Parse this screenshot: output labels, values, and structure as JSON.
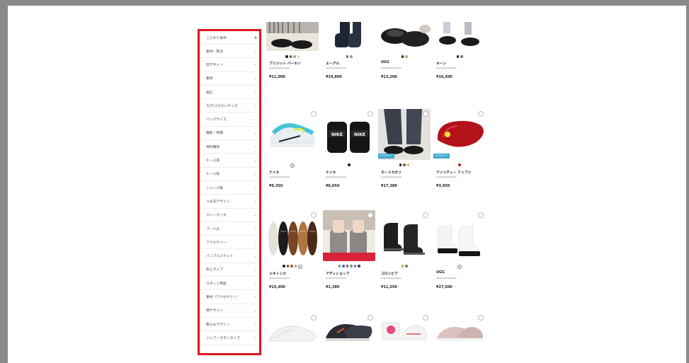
{
  "sidebar": {
    "header": "こだわり条件",
    "items": [
      "素材・製法",
      "前デザイン",
      "素材",
      "幅広",
      "大きい/小さいサイズ",
      "バッグサイズ",
      "機能・特徴",
      "材料種別",
      "ヒール高",
      "ヒール形",
      "シューズ幅",
      "つま先デザイン",
      "スニーカー丈",
      "ブーツ丈",
      "アクセサリー",
      "バンブルスケット",
      "刺上タイプ",
      "スポーツ用途",
      "素材（アクセサリー）",
      "柄デザイン",
      "靴ひもデザイン",
      "ジップ・ボタンタイプ"
    ]
  },
  "products": [
    {
      "brand": "ブリジット バーキン",
      "desc": "",
      "price": "¥11,000",
      "dots": [
        "#222",
        "#555",
        "#c9a56b",
        "#d8d0c0"
      ],
      "badge": ""
    },
    {
      "brand": "エーグル",
      "desc": "",
      "price": "¥19,800",
      "dots": [
        "#5a7a5a",
        "#8a9a8a"
      ],
      "badge": ""
    },
    {
      "brand": "UGG",
      "desc": "",
      "price": "¥13,200",
      "dots": [
        "#222",
        "#d6a060"
      ],
      "badge": ""
    },
    {
      "brand": "キーン",
      "desc": "",
      "price": "¥16,500",
      "dots": [
        "#222",
        "#6a7a6a"
      ],
      "badge": ""
    },
    {
      "brand": "ナイキ",
      "desc": "",
      "price": "¥9,350",
      "dots": [
        "#ddd"
      ],
      "badge": ""
    },
    {
      "brand": "ナイキ",
      "desc": "",
      "price": "¥6,050",
      "dots": [
        "#222"
      ],
      "badge": ""
    },
    {
      "brand": "モードカオリ",
      "desc": "",
      "price": "¥17,380",
      "dots": [
        "#222",
        "#8a5a3a",
        "#e0b080"
      ],
      "badge": "¥1000オフ"
    },
    {
      "brand": "アリリティー アップァ",
      "desc": "",
      "price": "¥3,850",
      "dots": [
        "#c8221a"
      ],
      "badge": "¥1000オフ"
    },
    {
      "brand": "ミネトンカ",
      "desc": "",
      "price": "¥15,400",
      "dots": [
        "#222",
        "#7a4a2a",
        "#a05a3a",
        "#c9a56b",
        "#ddd"
      ],
      "badge": ""
    },
    {
      "brand": "アディショップ",
      "desc": "",
      "price": "¥1,380",
      "dots": [
        "#888",
        "#3a7ac8",
        "#c83a5a",
        "#3ab08a",
        "#a05ac8",
        "#444"
      ],
      "badge": ""
    },
    {
      "brand": "コロンビア",
      "desc": "",
      "price": "¥11,550",
      "dots": [
        "#d6a060",
        "#5a8a5a"
      ],
      "badge": ""
    },
    {
      "brand": "UGG",
      "desc": "",
      "price": "¥27,500",
      "dots": [
        "#ddd"
      ],
      "badge": ""
    },
    {
      "brand": "",
      "desc": "",
      "price": "",
      "dots": [],
      "badge": ""
    },
    {
      "brand": "",
      "desc": "",
      "price": "",
      "dots": [],
      "badge": ""
    },
    {
      "brand": "",
      "desc": "",
      "price": "",
      "dots": [],
      "badge": ""
    },
    {
      "brand": "",
      "desc": "",
      "price": "",
      "dots": [],
      "badge": ""
    }
  ]
}
